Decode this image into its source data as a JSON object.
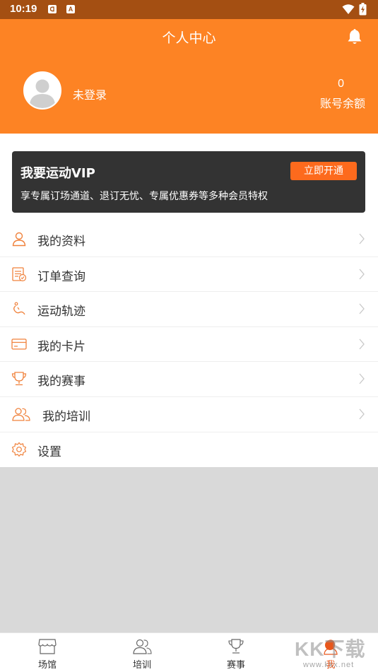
{
  "status_bar": {
    "time": "10:19",
    "icons": [
      "notification-icon",
      "a-icon",
      "wifi-icon",
      "battery-charging-icon"
    ],
    "notif_glyph": "ᗡ",
    "a_glyph": "A"
  },
  "header": {
    "title": "个人中心",
    "login_status": "未登录",
    "balance_value": "0",
    "balance_label": "账号余额",
    "color": "#fd8324"
  },
  "vip": {
    "title": "我要运动VIP",
    "button_label": "立即开通",
    "description": "享专属订场通道、退订无忧、专属优惠券等多种会员特权",
    "card_color": "#333333",
    "button_color": "#fd6a1d"
  },
  "menu": {
    "items": [
      {
        "label": "我的资料",
        "icon": "user-icon"
      },
      {
        "label": "订单查询",
        "icon": "order-icon"
      },
      {
        "label": "运动轨迹",
        "icon": "track-icon"
      },
      {
        "label": "我的卡片",
        "icon": "card-icon"
      },
      {
        "label": "我的赛事",
        "icon": "trophy-icon"
      },
      {
        "label": "我的培训",
        "icon": "training-icon"
      },
      {
        "label": "设置",
        "icon": "settings-icon"
      }
    ]
  },
  "tabbar": {
    "tabs": [
      {
        "label": "场馆",
        "icon": "venue-icon"
      },
      {
        "label": "培训",
        "icon": "training-icon"
      },
      {
        "label": "赛事",
        "icon": "trophy-icon"
      },
      {
        "label": "我",
        "icon": "profile-icon",
        "active": true
      }
    ],
    "active_color": "#e8571c"
  },
  "watermark": {
    "main": "KK下载",
    "sub": "www.kkx.net"
  }
}
